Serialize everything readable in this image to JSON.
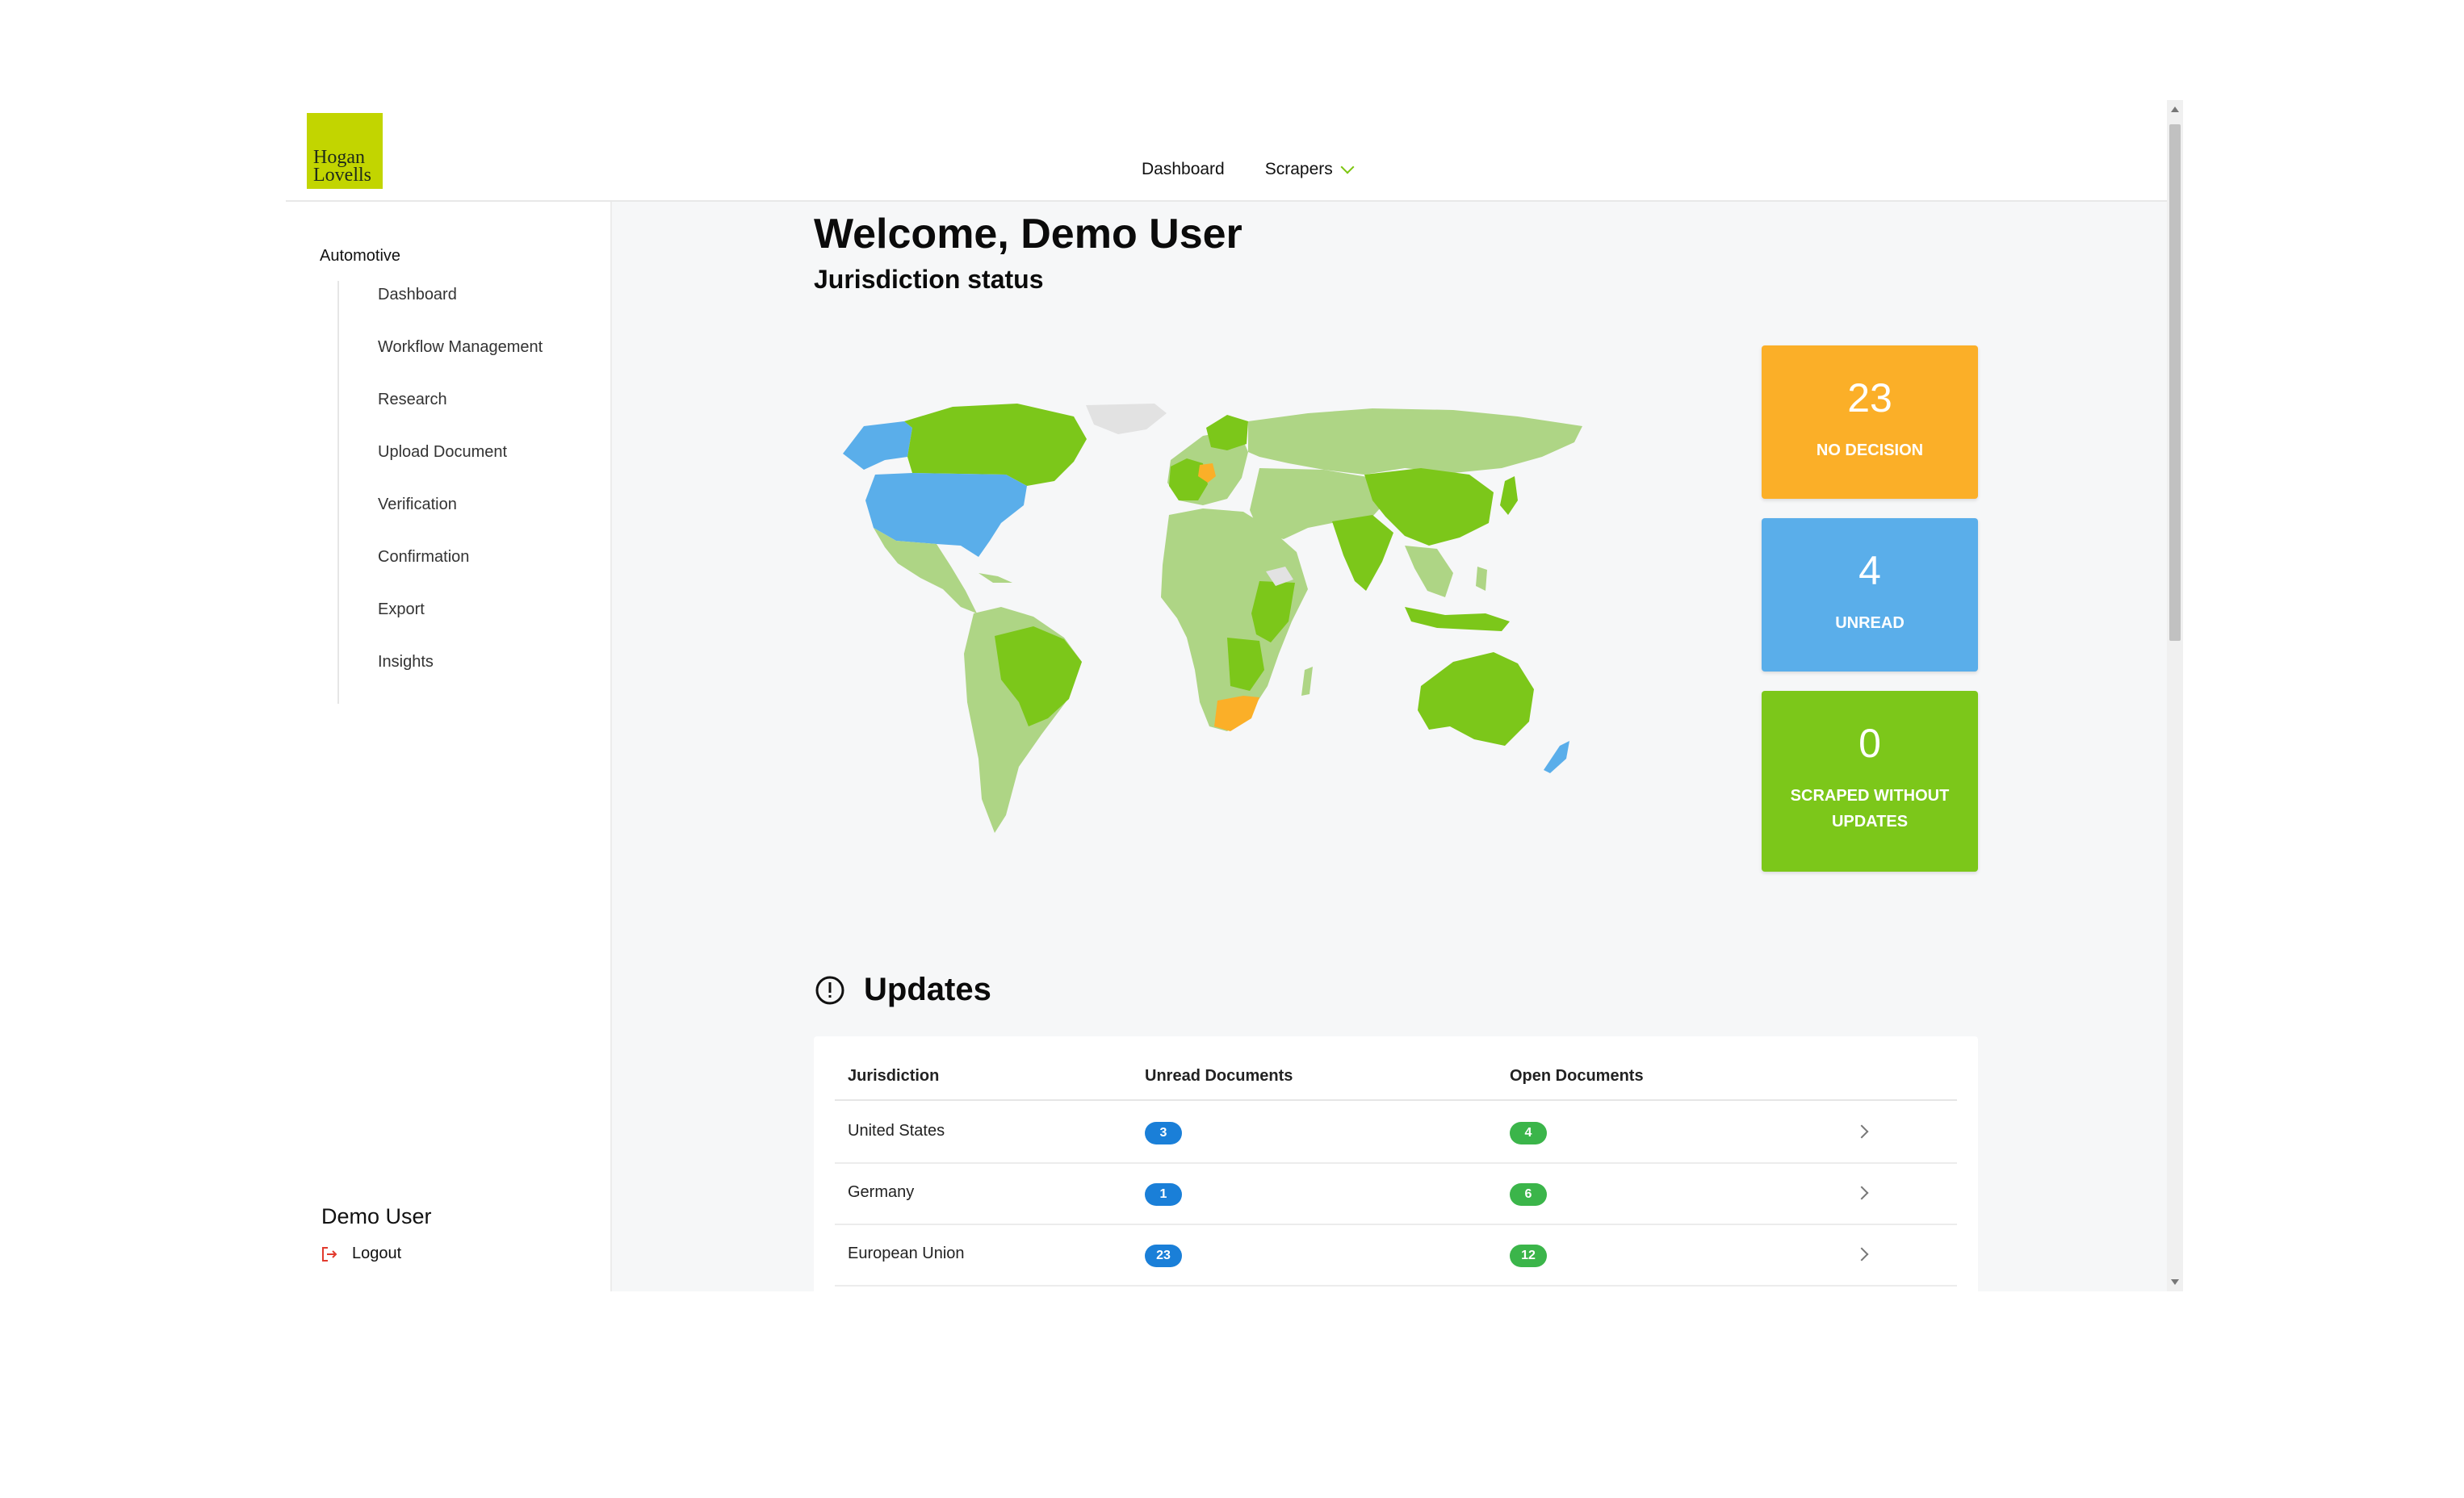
{
  "brand": {
    "logo_line1": "Hogan",
    "logo_line2": "Lovells",
    "logo_color": "#c2d500"
  },
  "topnav": {
    "dashboard": "Dashboard",
    "scrapers": "Scrapers"
  },
  "sidebar": {
    "group": "Automotive",
    "items": [
      {
        "label": "Dashboard"
      },
      {
        "label": "Workflow Management"
      },
      {
        "label": "Research"
      },
      {
        "label": "Upload Document"
      },
      {
        "label": "Verification"
      },
      {
        "label": "Confirmation"
      },
      {
        "label": "Export"
      },
      {
        "label": "Insights"
      }
    ],
    "user": "Demo User",
    "logout": "Logout"
  },
  "main": {
    "welcome": "Welcome, Demo User",
    "subtitle": "Jurisdiction status"
  },
  "map_legend_colors": {
    "no_decision": "#fbaf28",
    "unread": "#5aaeea",
    "scraped": "#7cc71a",
    "other": "#aed585",
    "no_data": "#e2e2e2"
  },
  "stats": {
    "no_decision": {
      "value": "23",
      "label": "NO DECISION"
    },
    "unread": {
      "value": "4",
      "label": "UNREAD"
    },
    "scraped": {
      "value": "0",
      "label": "SCRAPED WITHOUT UPDATES"
    }
  },
  "updates": {
    "title": "Updates",
    "columns": {
      "jurisdiction": "Jurisdiction",
      "unread": "Unread Documents",
      "open": "Open Documents"
    },
    "rows": [
      {
        "jurisdiction": "United States",
        "unread": "3",
        "open": "4"
      },
      {
        "jurisdiction": "Germany",
        "unread": "1",
        "open": "6"
      },
      {
        "jurisdiction": "European Union",
        "unread": "23",
        "open": "12"
      }
    ]
  }
}
